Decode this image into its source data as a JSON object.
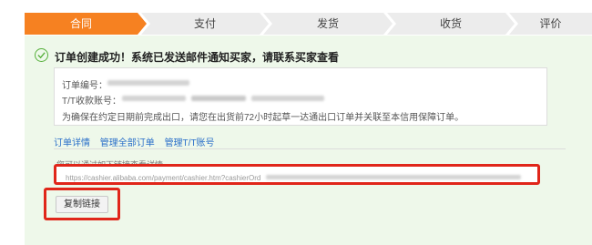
{
  "steps": [
    {
      "label": "合同"
    },
    {
      "label": "支付"
    },
    {
      "label": "发货"
    },
    {
      "label": "收货"
    },
    {
      "label": "评价"
    }
  ],
  "success": {
    "message": "订单创建成功！系统已发送邮件通知买家，请联系买家查看",
    "icon": "check-circle-icon",
    "color": "#57b03c"
  },
  "order_info": {
    "order_number_label": "订单编号：",
    "tt_account_label": "T/T收款账号：",
    "notice": "为确保在约定日期前完成出口，请您在出货前72小时起草一达通出口订单并关联至本信用保障订单。"
  },
  "actions": {
    "order_details": "订单详情",
    "manage_all_orders": "管理全部订单",
    "manage_tt_account": "管理T/T账号"
  },
  "link_section": {
    "hint": "您可以通过如下链接查看详情",
    "url": "https://cashier.alibaba.com/payment/cashier.htm?cashierOrd"
  },
  "copy_button": {
    "label": "复制链接"
  },
  "colors": {
    "accent": "#f68121",
    "highlight": "#e0261a",
    "panel_bg": "#eef8ea",
    "link": "#2a6fc9"
  }
}
